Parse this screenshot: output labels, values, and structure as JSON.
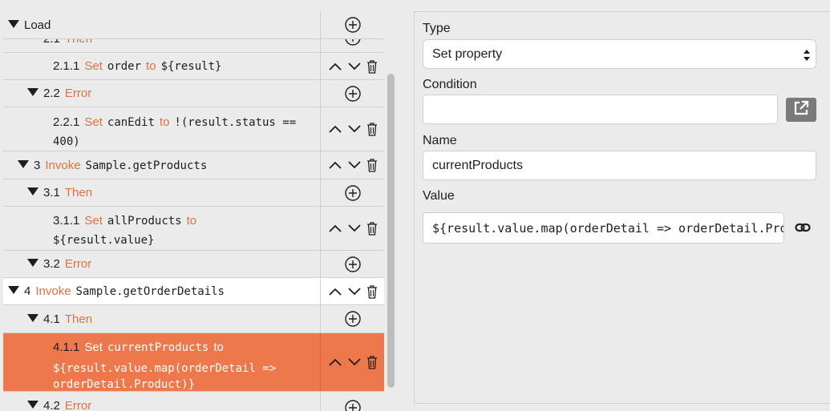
{
  "tree": {
    "root": {
      "label": "Load"
    },
    "rows": [
      {
        "num": "2.1",
        "kw": "Then",
        "partial": true
      },
      {
        "num": "2.1.1",
        "kw": "Set",
        "code": "order",
        "kw2": "to",
        "code2": "${result}"
      },
      {
        "num": "2.2",
        "kw": "Error"
      },
      {
        "num": "2.2.1",
        "kw": "Set",
        "code": "canEdit",
        "kw2": "to",
        "code2": "!(result.status ==",
        "code3": "400)"
      },
      {
        "num": "3",
        "kw": "Invoke",
        "code": "Sample.getProducts"
      },
      {
        "num": "3.1",
        "kw": "Then"
      },
      {
        "num": "3.1.1",
        "kw": "Set",
        "code": "allProducts",
        "kw2": "to",
        "code2": "${result.value}"
      },
      {
        "num": "3.2",
        "kw": "Error"
      },
      {
        "num": "4",
        "kw": "Invoke",
        "code": "Sample.getOrderDetails"
      },
      {
        "num": "4.1",
        "kw": "Then"
      },
      {
        "num": "4.1.1",
        "kw": "Set",
        "code": "currentProducts",
        "kw2": "to",
        "code2": "${result.value.map(orderDetail =>",
        "code3": "orderDetail.Product)}"
      },
      {
        "num": "4.2",
        "kw": "Error",
        "partial": true
      }
    ]
  },
  "props": {
    "type_label": "Type",
    "type_value": "Set property",
    "condition_label": "Condition",
    "condition_value": "",
    "name_label": "Name",
    "name_value": "currentProducts",
    "value_label": "Value",
    "value_value": "${result.value.map(orderDetail => orderDetail.Product)}"
  },
  "colors": {
    "accent": "#e07140",
    "selected_row": "#ec784c",
    "background": "#ebebeb"
  },
  "icons": [
    "triangle-down-icon",
    "add-circle-icon",
    "chevron-up-icon",
    "chevron-down-icon",
    "trash-icon",
    "open-external-icon",
    "link-icon",
    "select-arrows-icon"
  ]
}
